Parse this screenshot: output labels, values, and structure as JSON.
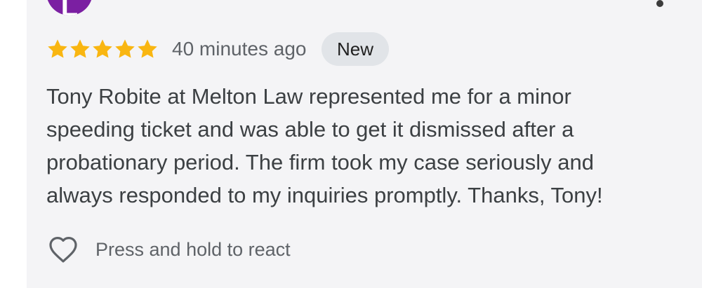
{
  "reviewer": {
    "avatar_letter": "L",
    "avatar_color": "#7b1fa2",
    "more_icon": "more-vert-icon"
  },
  "review": {
    "rating": 5,
    "rating_max": 5,
    "star_color": "#f9b611",
    "time_ago": "40 minutes ago",
    "badge": "New",
    "text": "Tony Robite at Melton Law represented me for a minor speeding ticket and was able to get it dismissed after a probationary period. The firm took my case seriously and always responded to my inquiries promptly. Thanks, Tony!"
  },
  "react": {
    "icon": "heart-outline-icon",
    "label": "Press and hold to react"
  }
}
